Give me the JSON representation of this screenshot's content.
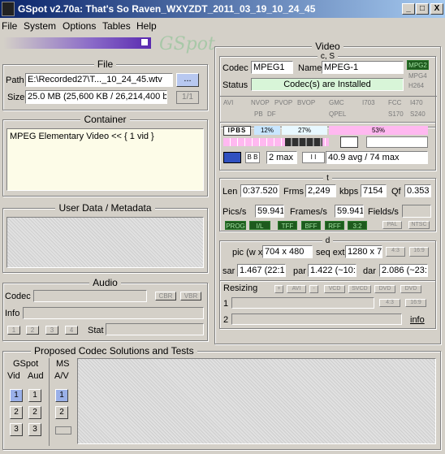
{
  "window": {
    "title": "GSpot v2.70a: That's So Raven_WXYZDT_2011_03_19_10_24_45",
    "min": "_",
    "max": "□",
    "close": "X"
  },
  "menu": [
    "File",
    "System",
    "Options",
    "Tables",
    "Help"
  ],
  "logo": "GSpot",
  "file": {
    "title": "File",
    "path_label": "Path",
    "path": "E:\\Recorded27\\T..._10_24_45.wtv",
    "browse": "...",
    "size_label": "Size",
    "size": "25.0 MB (25,600 KB / 26,214,400 b",
    "fraction": "1/1"
  },
  "container": {
    "title": "Container",
    "text": "MPEG Elementary Video << { 1 vid }"
  },
  "userdata": {
    "title": "User Data / Metadata"
  },
  "audio": {
    "title": "Audio",
    "codec_label": "Codec",
    "info_label": "Info",
    "stat_label": "Stat",
    "cbr": "CBR",
    "vbr": "VBR",
    "tracks": [
      "1",
      "2",
      "3",
      "4"
    ]
  },
  "video": {
    "title": "Video",
    "cs": "c, S",
    "codec_label": "Codec",
    "codec": "MPEG1",
    "name_label": "Name",
    "name": "MPEG-1",
    "status_label": "Status",
    "status": "Codec(s) are Installed",
    "badges": [
      "MPG2",
      "MPG4",
      "H264"
    ],
    "flags": [
      "AVI",
      "NVOP",
      "PVOP",
      "BVOP",
      "GMC",
      "I703",
      "FCC",
      "I470",
      "PB",
      "DF",
      "QPEL",
      "S170",
      "S240"
    ],
    "frames": {
      "ipbs": [
        "I",
        "P",
        "B",
        "S"
      ],
      "pct1": "12%",
      "pct2": "27%",
      "pct3": "53%"
    },
    "bmax": "2 max",
    "imax": "40.9 avg / 74 max",
    "t": "t",
    "len_label": "Len",
    "len": "0:37.520",
    "frms_label": "Frms",
    "frms": "2,249",
    "kbps_label": "kbps",
    "kbps": "7154",
    "qf_label": "Qf",
    "qf": "0.353",
    "pics_label": "Pics/s",
    "pics": "59.941",
    "framess_label": "Frames/s",
    "framess": "59.941",
    "fields_label": "Fields/s",
    "fields": "",
    "prog": [
      "PROG",
      "I/L",
      "TFF",
      "BFF",
      "RFF",
      "3:2",
      "PAL",
      "NTSC"
    ],
    "d": "d",
    "pic_label": "pic (w x",
    "pic": "704 x 480",
    "seqext_label": "seq ext",
    "seqext": "1280 x 7",
    "r43": "4:3",
    "r169": "16:9",
    "sar_label": "sar",
    "sar": "1.467 (22:15",
    "par_label": "par",
    "par": "1.422 (~10:",
    "dar_label": "dar",
    "dar": "2.086 (~23:",
    "resizing": "Resizing",
    "resize_btns": [
      "+",
      "AVI",
      "-",
      "VCD",
      "SVCD",
      "DVD",
      "DVD"
    ],
    "r1": "1",
    "r2": "2",
    "info": "info"
  },
  "solutions": {
    "title": "Proposed Codec Solutions and Tests",
    "gspot": "GSpot",
    "vid": "Vid",
    "aud": "Aud",
    "ms": "MS",
    "av": "A/V",
    "nums": [
      "1",
      "2",
      "3"
    ]
  },
  "colors": {
    "titlebar_start": "#0a246a",
    "titlebar_end": "#a6caf0",
    "status_bg": "#d8f5d8",
    "green": "#6ad06a",
    "pink": "#ffb8f0"
  }
}
